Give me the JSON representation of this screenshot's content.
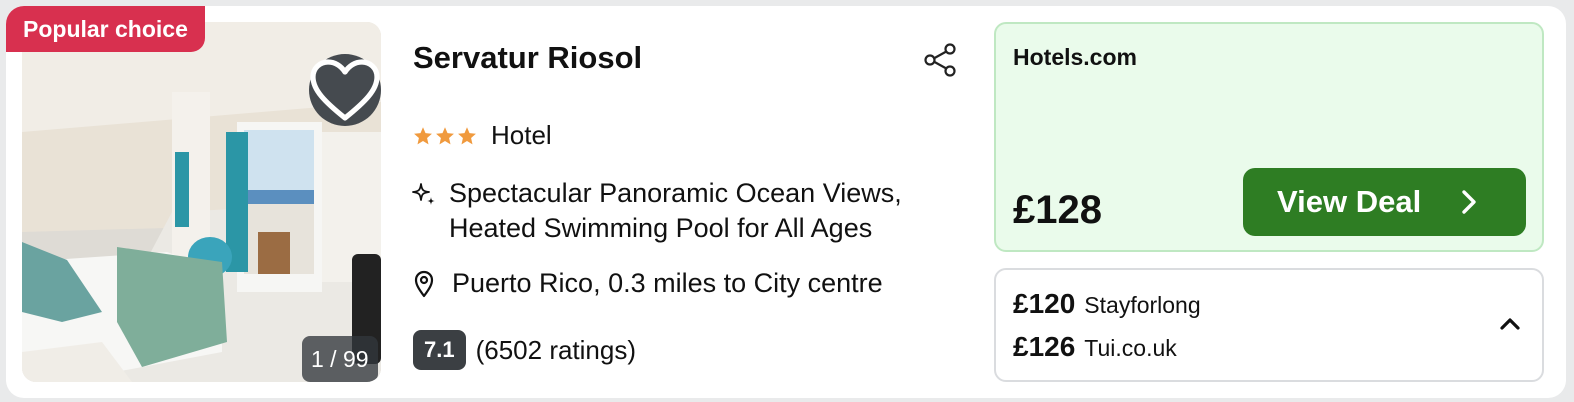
{
  "badge": {
    "label": "Popular choice"
  },
  "photo": {
    "counter": "1 / 99",
    "icon": "heart-icon"
  },
  "hotel": {
    "name": "Servatur Riosol",
    "star_count": 3,
    "type": "Hotel",
    "highlight": "Spectacular Panoramic Ocean Views, Heated Swimming Pool for All Ages",
    "location": "Puerto Rico, 0.3 miles to City centre",
    "score": "7.1",
    "ratings": "(6502 ratings)"
  },
  "main_deal": {
    "provider": "Hotels.com",
    "price": "£128",
    "button_label": "View Deal"
  },
  "other_deals": [
    {
      "price": "£120",
      "provider": "Stayforlong"
    },
    {
      "price": "£126",
      "provider": "Tui.co.uk"
    }
  ],
  "colors": {
    "badge": "#d8304f",
    "star": "#f09a3e",
    "deal_button": "#2e7d23",
    "deal_bg": "#eafbeb",
    "score_bg": "#3b3f43"
  }
}
